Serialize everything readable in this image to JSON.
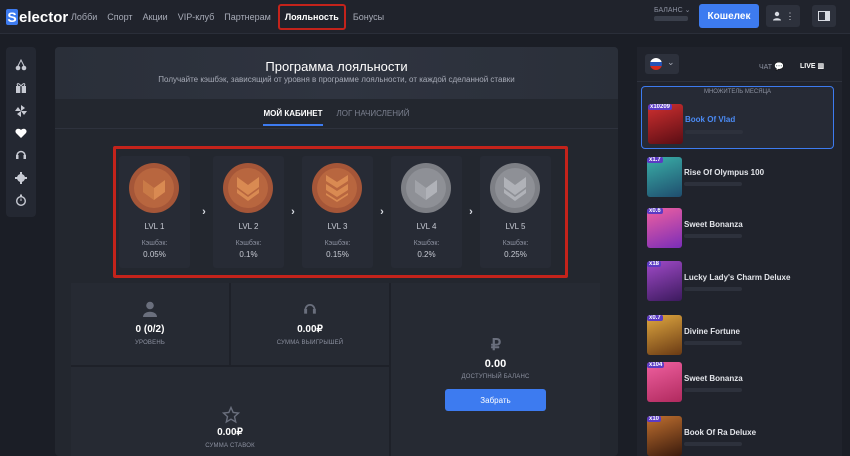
{
  "header": {
    "logo_letter": "S",
    "logo_text": "elector",
    "nav": [
      {
        "label": "Лобби"
      },
      {
        "label": "Спорт"
      },
      {
        "label": "Акции"
      },
      {
        "label": "VIP-клуб"
      },
      {
        "label": "Партнерам"
      },
      {
        "label": "Лояльность",
        "active": true
      },
      {
        "label": "Бонусы"
      }
    ],
    "balance_label": "БАЛАНС",
    "wallet_label": "Кошелек"
  },
  "rail": {
    "icons": [
      "cherries-icon",
      "gift-icon",
      "pinwheel-icon",
      "heart-icon",
      "headset-icon",
      "gear-icon",
      "stopwatch-icon"
    ]
  },
  "loyalty": {
    "title": "Программа лояльности",
    "subtitle": "Получайте кэшбэк, зависящий от уровня в программе лояльности, от каждой сделанной ставки",
    "tabs": [
      {
        "label": "МОЙ КАБИНЕТ",
        "active": true
      },
      {
        "label": "ЛОГ НАЧИСЛЕНИЙ",
        "active": false
      }
    ],
    "levels": [
      {
        "name": "LVL 1",
        "cashback_label": "Кэшбэк:",
        "cashback": "0.05%",
        "unlocked": true
      },
      {
        "name": "LVL 2",
        "cashback_label": "Кэшбэк:",
        "cashback": "0.1%",
        "unlocked": true
      },
      {
        "name": "LVL 3",
        "cashback_label": "Кэшбэк:",
        "cashback": "0.15%",
        "unlocked": true
      },
      {
        "name": "LVL 4",
        "cashback_label": "Кэшбэк:",
        "cashback": "0.2%",
        "unlocked": false
      },
      {
        "name": "LVL 5",
        "cashback_label": "Кэшбэк:",
        "cashback": "0.25%",
        "unlocked": false
      }
    ],
    "stats": {
      "level_value": "0 (0/2)",
      "level_label": "УРОВЕНЬ",
      "winnings_value": "0.00₽",
      "winnings_label": "СУММА ВЫИГРЫШЕЙ",
      "bets_value": "0.00₽",
      "bets_label": "СУММА СТАВОК",
      "available_value": "0.00",
      "available_label": "ДОСТУПНЫЙ БАЛАНС",
      "claim_label": "Забрать"
    }
  },
  "right_panel": {
    "chat_label": "ЧАТ",
    "live_label": "LIVE",
    "month_label": "МНОЖИТЕЛЬ МЕСЯЦА",
    "games": [
      {
        "name": "Book Of Vlad",
        "mult": "x10209",
        "featured": true,
        "color": "#b0202a"
      },
      {
        "name": "Rise Of Olympus 100",
        "mult": "x1.7",
        "featured": false,
        "color": "#2b7a7e"
      },
      {
        "name": "Sweet Bonanza",
        "mult": "x0.6",
        "featured": false,
        "color": "#e0408a"
      },
      {
        "name": "Lucky Lady's Charm Deluxe",
        "mult": "x18",
        "featured": false,
        "color": "#7a2d9a"
      },
      {
        "name": "Divine Fortune",
        "mult": "x0.7",
        "featured": false,
        "color": "#c78a2a"
      },
      {
        "name": "Sweet Bonanza",
        "mult": "x104",
        "featured": false,
        "color": "#e0408a"
      },
      {
        "name": "Book Of Ra Deluxe",
        "mult": "x10",
        "featured": false,
        "color": "#8a3a1a"
      }
    ]
  }
}
